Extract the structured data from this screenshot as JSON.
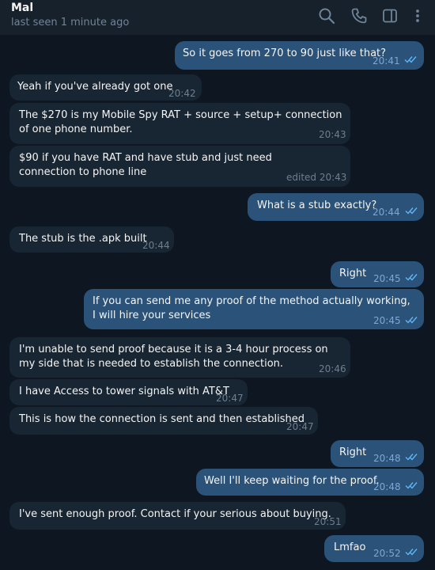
{
  "header": {
    "name": "Mal",
    "status": "last seen 1 minute ago",
    "icons": [
      "search-icon",
      "phone-icon",
      "sidebar-icon",
      "more-vertical-icon"
    ]
  },
  "colors": {
    "background": "#0e1621",
    "header": "#17212b",
    "incoming_bubble": "#182533",
    "outgoing_bubble": "#2b5278",
    "tick": "#5eb5f7"
  },
  "messages": [
    {
      "dir": "out",
      "text": "So it goes from 270 to 90 just like that?",
      "time": "20:41",
      "read": true
    },
    {
      "dir": "in",
      "text": "Yeah if you've already got one",
      "time": "20:42"
    },
    {
      "dir": "in",
      "text": "The $270 is my Mobile Spy RAT + source + setup+ connection of one phone number.",
      "time": "20:43"
    },
    {
      "dir": "in",
      "text": "$90 if you have RAT and have stub and just need connection to phone line",
      "time": "edited 20:43"
    },
    {
      "dir": "out",
      "text": "What is a stub exactly?",
      "time": "20:44",
      "read": true
    },
    {
      "dir": "in",
      "text": "The stub is the .apk built",
      "time": "20:44"
    },
    {
      "dir": "out",
      "text": "Right",
      "time": "20:45",
      "read": true
    },
    {
      "dir": "out",
      "text": "If you can send me any proof of the method actually working, I will hire your services",
      "time": "20:45",
      "read": true
    },
    {
      "dir": "in",
      "text": "I'm unable to send proof because it is a 3-4 hour process on my side that is needed to establish the connection.",
      "time": "20:46"
    },
    {
      "dir": "in",
      "text": "I have Access to tower signals with AT&T",
      "time": "20:47"
    },
    {
      "dir": "in",
      "text": "This is how the connection is sent and then established",
      "time": "20:47"
    },
    {
      "dir": "out",
      "text": "Right",
      "time": "20:48",
      "read": true
    },
    {
      "dir": "out",
      "text": "Well I'll keep waiting for the proof.",
      "time": "20:48",
      "read": true
    },
    {
      "dir": "in",
      "text": "I've sent enough proof. Contact if your serious about buying.",
      "time": "20:51"
    },
    {
      "dir": "out",
      "text": "Lmfao",
      "time": "20:52",
      "read": true
    }
  ]
}
